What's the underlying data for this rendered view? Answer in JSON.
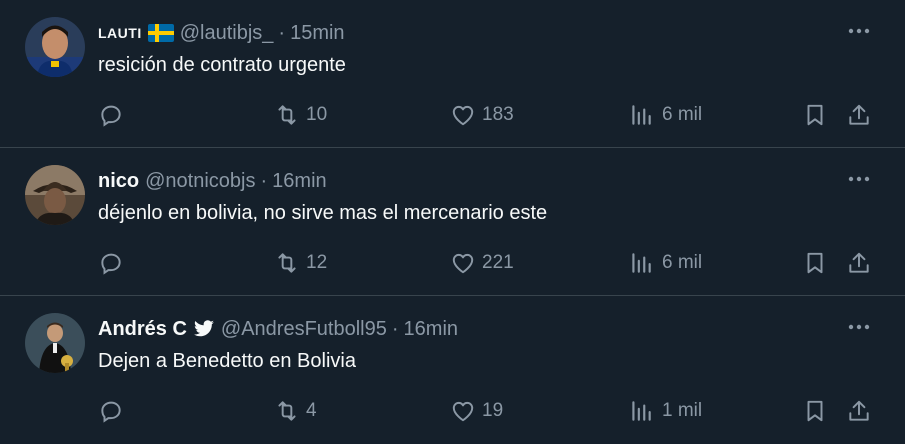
{
  "tweets": [
    {
      "name": "LAUTI",
      "flag": "sweden-flag",
      "handle": "@lautibjs_",
      "time": "15min",
      "text": "resición de contrato urgente",
      "replies": "",
      "retweets": "10",
      "likes": "183",
      "views": "6 mil"
    },
    {
      "name": "nico",
      "handle": "@notnicobjs",
      "time": "16min",
      "text": "déjenlo en bolivia, no sirve mas el mercenario este",
      "replies": "",
      "retweets": "12",
      "likes": "221",
      "views": "6 mil"
    },
    {
      "name": "Andrés C",
      "badge": "twitter-bird-icon",
      "handle": "@AndresFutboll95",
      "time": "16min",
      "text": "Dejen a Benedetto en Bolivia",
      "replies": "",
      "retweets": "4",
      "likes": "19",
      "views": "1 mil"
    }
  ],
  "separator": "·",
  "colors": {
    "background": "#15202b",
    "text": "#f7f9f9",
    "muted": "#8b98a5",
    "border": "#38444d"
  }
}
